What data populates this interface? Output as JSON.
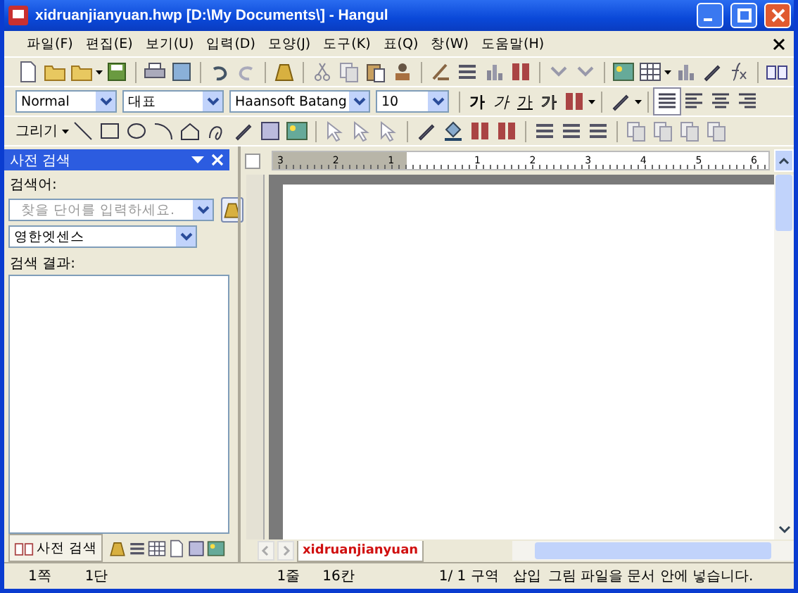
{
  "window": {
    "title": "xidruanjianyuan.hwp [D:\\My Documents\\] - Hangul"
  },
  "menu": [
    "파일(F)",
    "편집(E)",
    "보기(U)",
    "입력(D)",
    "모양(J)",
    "도구(K)",
    "표(Q)",
    "창(W)",
    "도움말(H)"
  ],
  "format_bar": {
    "style": "Normal",
    "font_group": "대표",
    "font": "Haansoft Batang",
    "size": "10",
    "char_buttons": [
      {
        "label": "가",
        "kind": "bold"
      },
      {
        "label": "가",
        "kind": "italic"
      },
      {
        "label": "가",
        "kind": "underline"
      },
      {
        "label": "가",
        "kind": "outline"
      }
    ],
    "align": [
      {
        "kind": "justify",
        "selected": true
      },
      {
        "kind": "left",
        "selected": false
      },
      {
        "kind": "center",
        "selected": false
      },
      {
        "kind": "right",
        "selected": false
      }
    ]
  },
  "draw_bar": {
    "label": "그리기"
  },
  "panel": {
    "title": "사전 검색",
    "search_label": "검색어:",
    "search_placeholder": "찾을 단어를 입력하세요.",
    "dictionary": "영한엣센스",
    "results_label": "검색 결과:",
    "tab": "사전 검색"
  },
  "ruler": {
    "labels": [
      "3",
      "2",
      "1",
      "1",
      "2",
      "3",
      "4",
      "5",
      "6"
    ]
  },
  "doc_tab": "xidruanjianyuan",
  "status_bar": [
    "1쪽",
    "1단",
    "1줄",
    "16칸",
    "1/  1 구역",
    "삽입",
    "그림 파일을 문서 안에 넣습니다."
  ]
}
